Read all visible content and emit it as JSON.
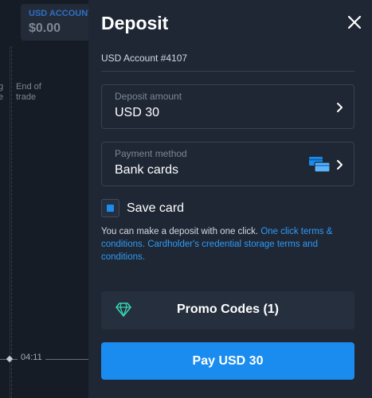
{
  "background": {
    "account_label": "USD ACCOUNT",
    "account_balance": "$0.00",
    "left_text": "g\ne",
    "end_of_trade": "End of\ntrade",
    "time": "04:11"
  },
  "panel": {
    "title": "Deposit",
    "account_id": "USD Account #4107",
    "amount": {
      "label": "Deposit amount",
      "value": "USD 30"
    },
    "method": {
      "label": "Payment method",
      "value": "Bank cards",
      "icon": "bank-cards-icon"
    },
    "save_card": {
      "label": "Save card",
      "checked": true
    },
    "info": {
      "text": "You can make a deposit with one click. ",
      "link1": "One click terms & conditions.",
      "link2": "Cardholder's credential storage terms and conditions."
    },
    "promo": {
      "label": "Promo Codes (1)",
      "icon": "diamond-icon"
    },
    "pay_button": "Pay USD 30"
  },
  "colors": {
    "accent": "#1a8cf0",
    "link": "#2e9af5",
    "panel_bg": "#1f2735",
    "promo_icon": "#36d3b5"
  }
}
